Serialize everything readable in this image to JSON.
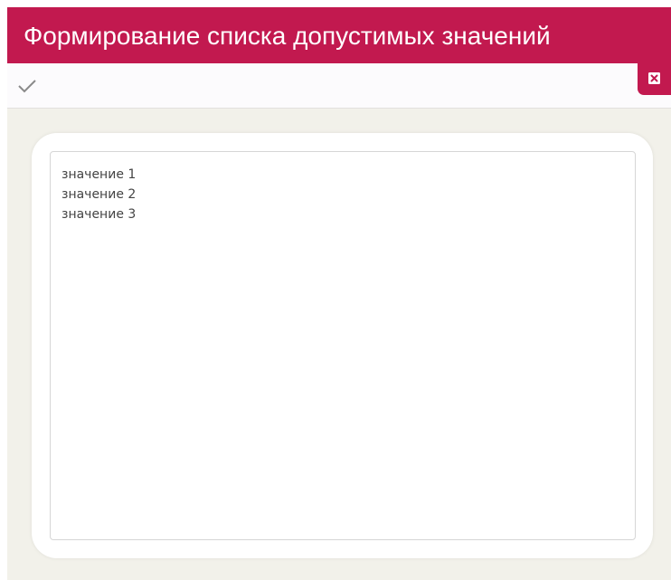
{
  "window": {
    "title": "Формирование списка допустимых значений"
  },
  "toolbar": {
    "apply_icon": "checkmark-icon",
    "close_icon": "close-icon"
  },
  "editor": {
    "value": "значение 1\nзначение 2\nзначение 3"
  },
  "colors": {
    "accent": "#c2194f",
    "background": "#f2f1ea",
    "text": "#444444"
  }
}
